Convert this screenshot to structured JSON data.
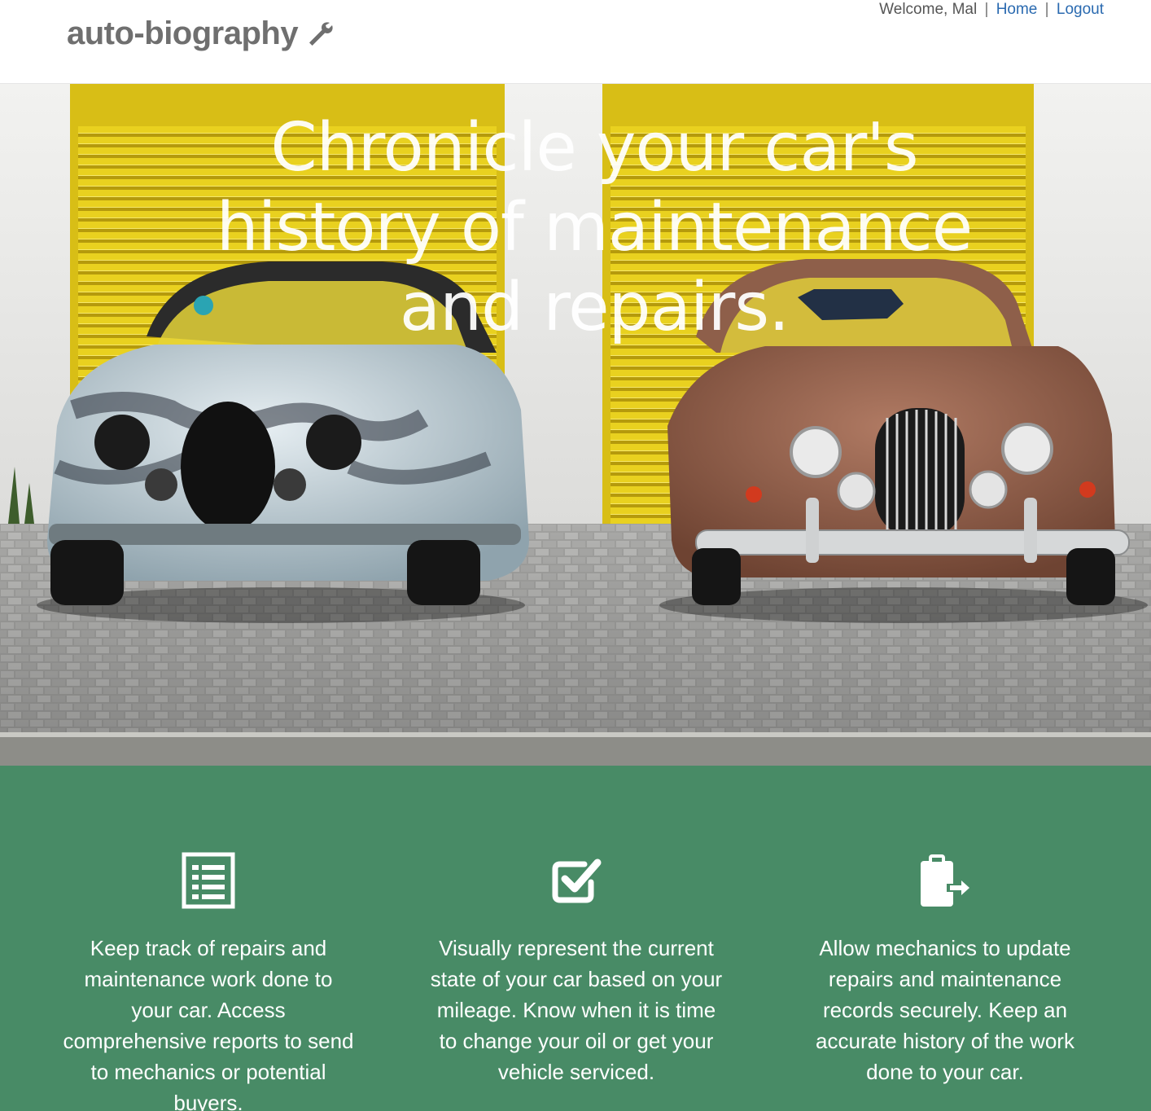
{
  "header": {
    "brand": "auto-biography",
    "brand_icon": "wrench-icon",
    "welcome": "Welcome, Mal",
    "separator": "|",
    "home_link": "Home",
    "logout_link": "Logout"
  },
  "hero": {
    "headline": "Chronicle your car's history of maintenance and repairs."
  },
  "features": [
    {
      "icon": "list-icon",
      "text": "Keep track of repairs and maintenance work done to your car. Access comprehensive reports to send to mechanics or potential buyers."
    },
    {
      "icon": "checkbox-icon",
      "text": "Visually represent the current state of your car based on your mileage. Know when it is time to change your oil or get your vehicle serviced."
    },
    {
      "icon": "clipboard-arrow-icon",
      "text": "Allow mechanics to update repairs and maintenance records securely. Keep an accurate history of the work done to your car."
    }
  ],
  "colors": {
    "features_background": "#488b66",
    "link": "#2a6ab0",
    "brand_text": "#6f6f6f",
    "garage_door_yellow": "#e8cf1d"
  }
}
